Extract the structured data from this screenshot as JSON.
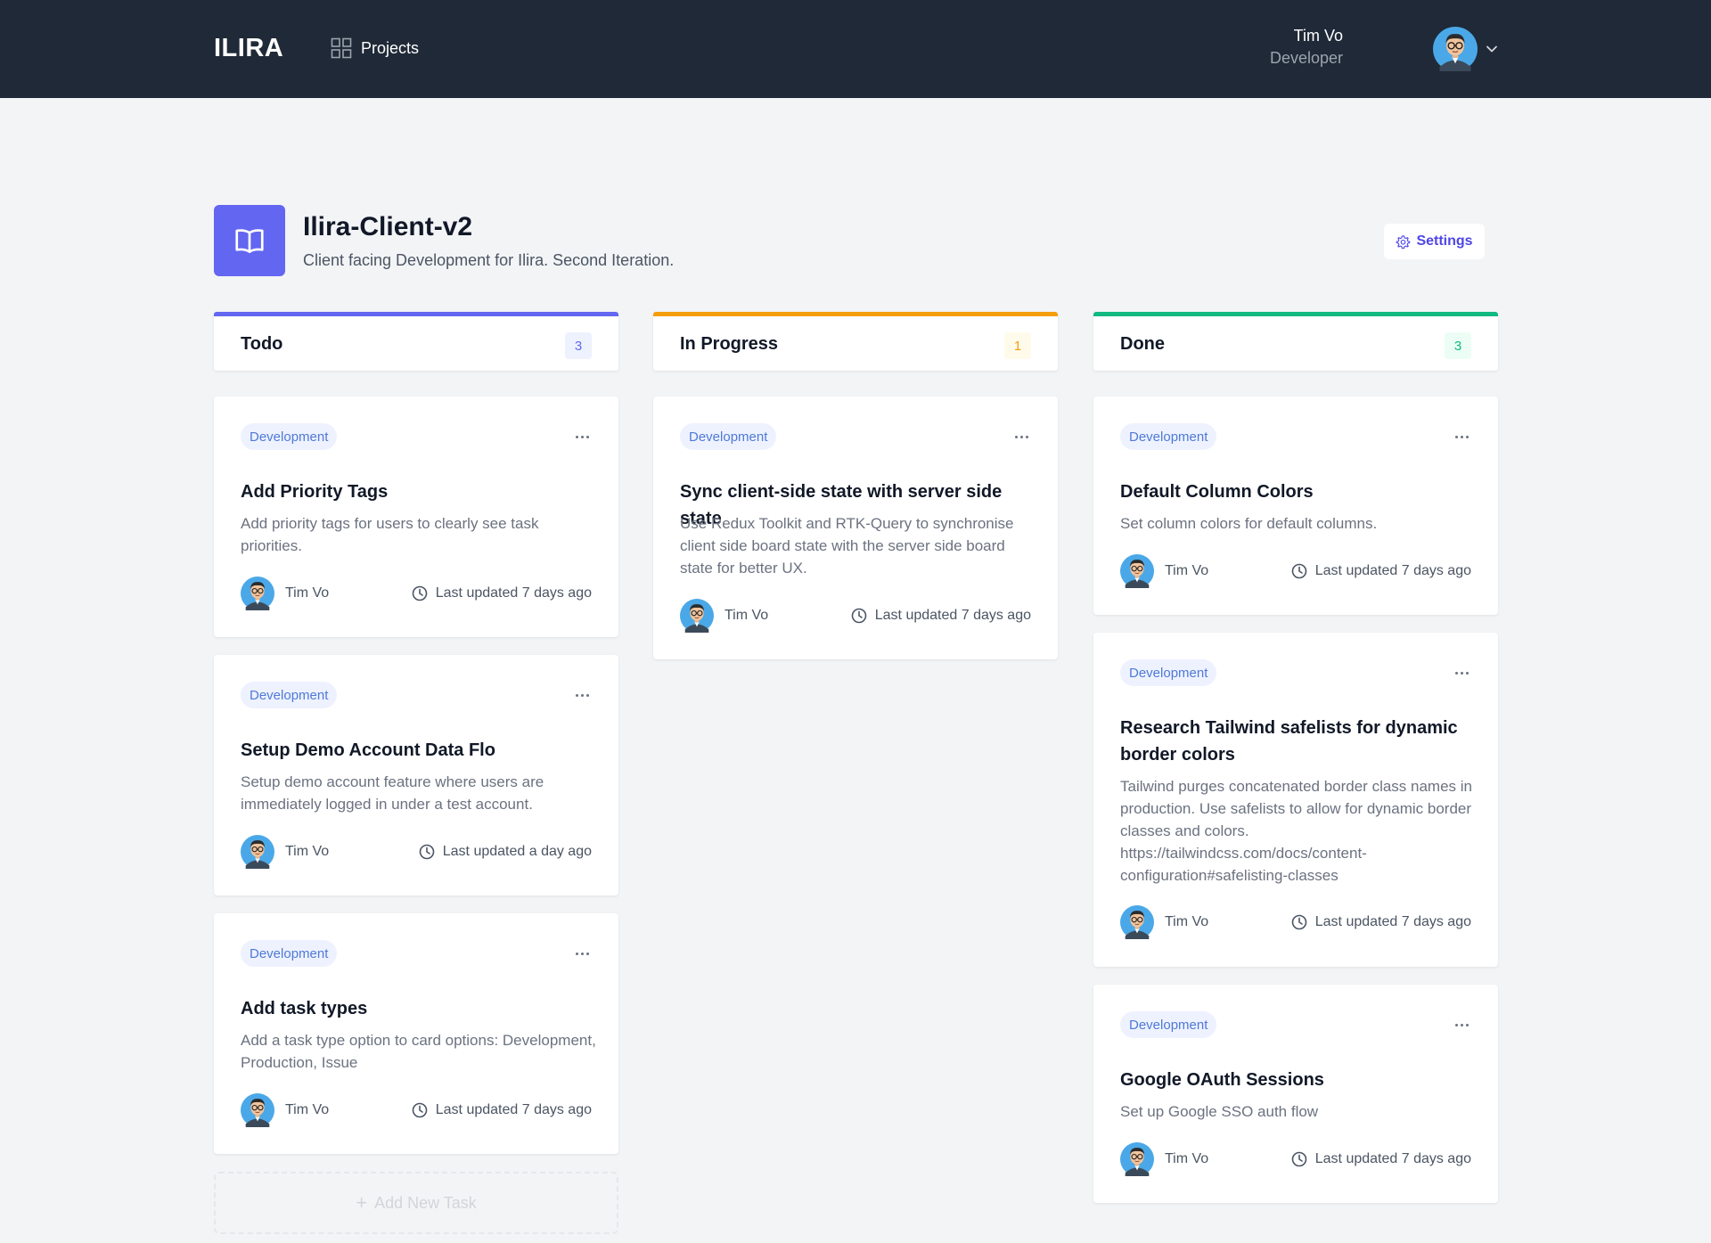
{
  "header": {
    "logo": "ILIRA",
    "nav": {
      "projects_label": "Projects",
      "icon": "grid-icon"
    },
    "user": {
      "name": "Tim Vo",
      "role": "Developer"
    }
  },
  "project": {
    "title": "Ilira-Client-v2",
    "description": "Client facing Development for Ilira. Second Iteration.",
    "icon": "book-icon",
    "settings_label": "Settings"
  },
  "columns": [
    {
      "title": "Todo",
      "count": "3",
      "color": "#6366f1",
      "cards": [
        {
          "tag": "Development",
          "title": "Add Priority Tags",
          "description": "Add priority tags for users to clearly see task priorities.",
          "user": "Tim Vo",
          "updated": "Last updated 7 days ago"
        },
        {
          "tag": "Development",
          "title": "Setup Demo Account Data Flo",
          "description": "Setup demo account feature where users are immediately logged in under a test account.",
          "user": "Tim Vo",
          "updated": "Last updated a day ago"
        },
        {
          "tag": "Development",
          "title": "Add task types",
          "description": "Add a task type option to card options: Development, Production, Issue",
          "user": "Tim Vo",
          "updated": "Last updated 7 days ago"
        }
      ],
      "add_label": "Add New Task"
    },
    {
      "title": "In Progress",
      "count": "1",
      "color": "#f59e0b",
      "cards": [
        {
          "tag": "Development",
          "title": "Sync client-side state with server side state",
          "description": "Use Redux Toolkit and RTK-Query to synchronise client side board state with the server side board state for better UX.",
          "user": "Tim Vo",
          "updated": "Last updated 7 days ago"
        }
      ]
    },
    {
      "title": "Done",
      "count": "3",
      "color": "#10b981",
      "cards": [
        {
          "tag": "Development",
          "title": "Default Column Colors",
          "description": "Set column colors for default columns.",
          "user": "Tim Vo",
          "updated": "Last updated 7 days ago"
        },
        {
          "tag": "Development",
          "title": "Research Tailwind safelists for dynamic border colors",
          "description": "Tailwind purges concatenated border class names in production. Use safelists to allow for dynamic border classes and colors. https://tailwindcss.com/docs/content-configuration#safelisting-classes",
          "user": "Tim Vo",
          "updated": "Last updated 7 days ago"
        },
        {
          "tag": "Development",
          "title": "Google OAuth Sessions",
          "description": "Set up Google SSO auth flow",
          "user": "Tim Vo",
          "updated": "Last updated 7 days ago"
        }
      ]
    }
  ]
}
